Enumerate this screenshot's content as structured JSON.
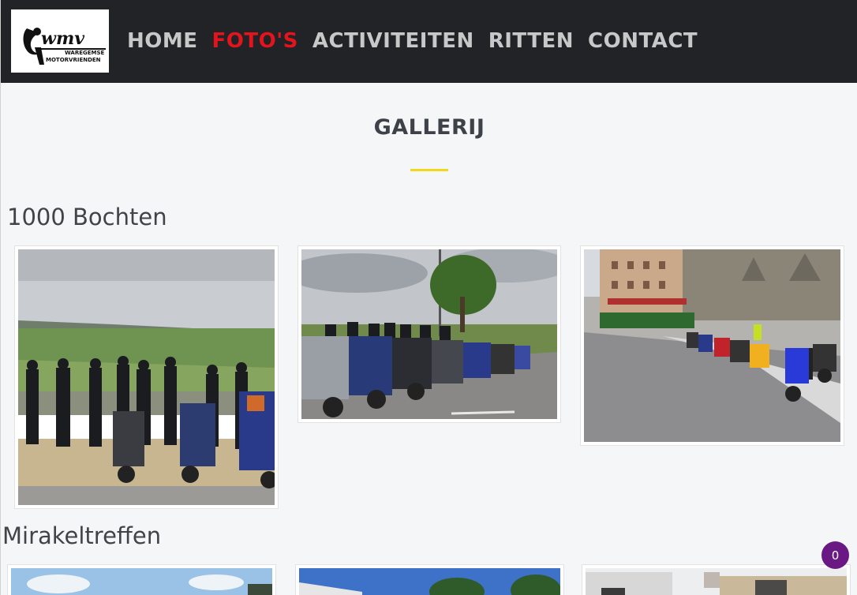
{
  "logo": {
    "brand": "wmv",
    "line1": "WAREGEMSE",
    "line2": "MOTORVRIENDEN"
  },
  "nav": {
    "home": "HOME",
    "fotos": "FOTO'S",
    "activiteiten": "ACTIVITEITEN",
    "ritten": "RITTEN",
    "contact": "CONTACT",
    "active": "FOTO'S"
  },
  "gallery": {
    "title": "GALLERIJ",
    "sections": [
      {
        "title": "1000 Bochten"
      },
      {
        "title": "Mirakeltreffen"
      }
    ]
  },
  "badge": {
    "count": "0"
  },
  "colors": {
    "header_bg": "#212327",
    "nav_text": "#c8c8c8",
    "nav_active": "#e3141c",
    "accent_underline": "#f2d81a",
    "badge": "#6a1883",
    "page_bg": "#f5f6f8"
  }
}
